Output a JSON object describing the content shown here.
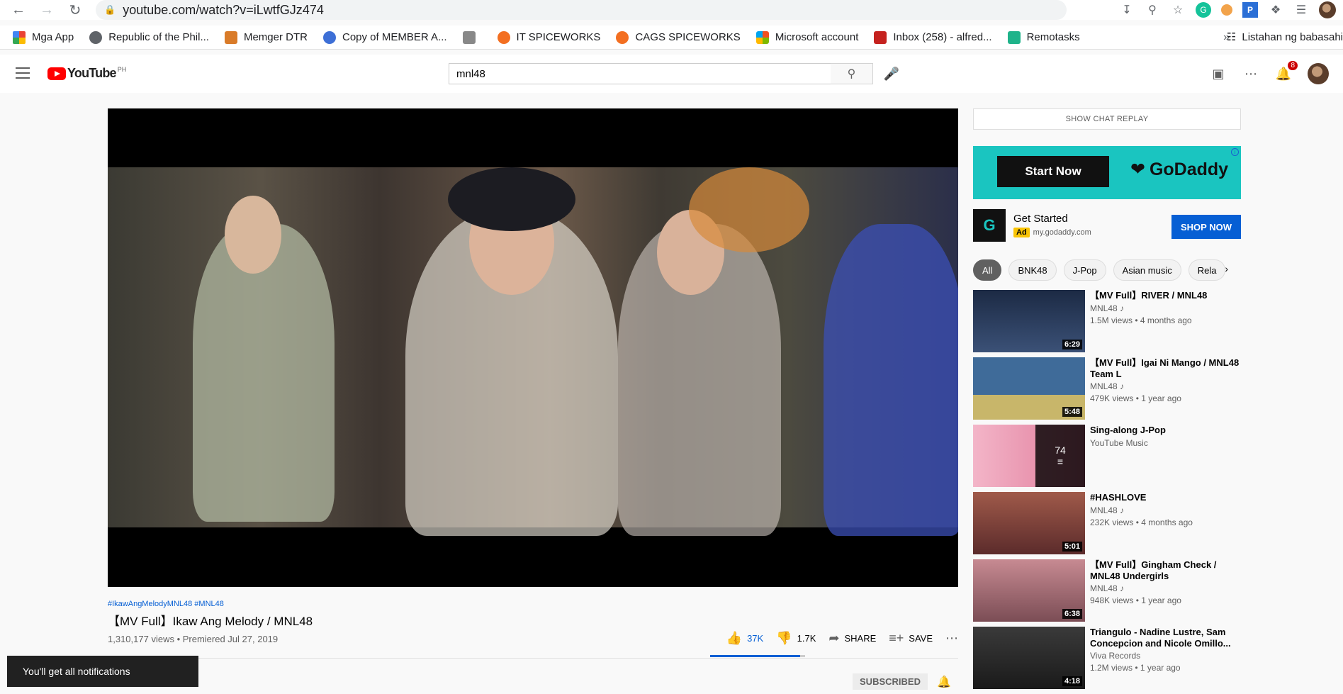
{
  "browser": {
    "url": "youtube.com/watch?v=iLwtfGJz474",
    "bookmarks": [
      {
        "label": "Mga App",
        "color": "#ea4335"
      },
      {
        "label": "Republic of the Phil...",
        "color": "#5f6368"
      },
      {
        "label": "Memger DTR",
        "color": "#d97b29"
      },
      {
        "label": "Copy of MEMBER A...",
        "color": "#3d6fd6"
      },
      {
        "label": "",
        "color": "#888888"
      },
      {
        "label": "IT SPICEWORKS",
        "color": "#f36f21"
      },
      {
        "label": "CAGS SPICEWORKS",
        "color": "#f36f21"
      },
      {
        "label": "Microsoft account",
        "color": "#00a4ef"
      },
      {
        "label": "Inbox (258) - alfred...",
        "color": "#c5221f"
      },
      {
        "label": "Remotasks",
        "color": "#1fb38a"
      }
    ],
    "more": "»",
    "reading_list": "Listahan ng babasahi"
  },
  "header": {
    "logo": "YouTube",
    "country": "PH",
    "search_value": "mnl48",
    "notification_count": "8"
  },
  "video": {
    "hashtags": "#IkawAngMelodyMNL48 #MNL48",
    "title": "【MV Full】Ikaw Ang Melody / MNL48",
    "meta": "1,310,177 views • Premiered Jul 27, 2019",
    "likes": "37K",
    "dislikes": "1.7K",
    "like_ratio": 0.95,
    "share": "SHARE",
    "save": "SAVE",
    "subscribed": "SUBSCRIBED"
  },
  "toast": "You'll get all notifications",
  "sidebar": {
    "chat_replay": "SHOW CHAT REPLAY",
    "ad_banner": {
      "start": "Start Now",
      "brand": "GoDaddy"
    },
    "ad_card": {
      "title": "Get Started",
      "tag": "Ad",
      "domain": "my.godaddy.com",
      "cta": "SHOP NOW"
    },
    "chips": [
      "All",
      "BNK48",
      "J-Pop",
      "Asian music",
      "Rela"
    ],
    "recs": [
      {
        "title": "【MV Full】RIVER / MNL48",
        "channel": "MNL48 ♪",
        "meta": "1.5M views • 4 months ago",
        "duration": "6:29",
        "thumb": "#2b3d5c"
      },
      {
        "title": "【MV Full】Igai Ni Mango / MNL48 Team L",
        "channel": "MNL48 ♪",
        "meta": "479K views • 1 year ago",
        "duration": "5:48",
        "thumb": "#3f6b99"
      },
      {
        "title": "Sing-along J-Pop",
        "channel": "YouTube Music",
        "meta": "",
        "duration": "",
        "playlist": "74",
        "thumb": "#e991b2"
      },
      {
        "title": "#HASHLOVE",
        "channel": "MNL48 ♪",
        "meta": "232K views • 4 months ago",
        "duration": "5:01",
        "thumb": "#8a3b3b"
      },
      {
        "title": "【MV Full】Gingham Check / MNL48 Undergirls",
        "channel": "MNL48 ♪",
        "meta": "948K views • 1 year ago",
        "duration": "6:38",
        "thumb": "#9c6a72"
      },
      {
        "title": "Triangulo - Nadine Lustre, Sam Concepcion and Nicole Omillo...",
        "channel": "Viva Records",
        "meta": "1.2M views • 1 year ago",
        "duration": "4:18",
        "thumb": "#2a2a2a"
      }
    ]
  }
}
